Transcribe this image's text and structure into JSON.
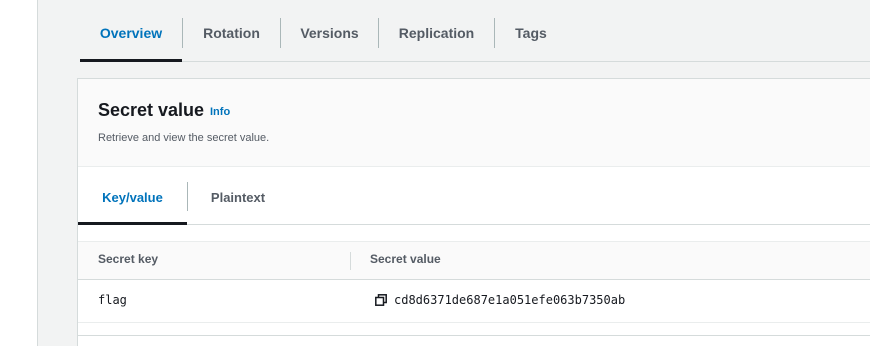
{
  "top_tabs": [
    {
      "label": "Overview",
      "active": true
    },
    {
      "label": "Rotation",
      "active": false
    },
    {
      "label": "Versions",
      "active": false
    },
    {
      "label": "Replication",
      "active": false
    },
    {
      "label": "Tags",
      "active": false
    }
  ],
  "secret_panel": {
    "title": "Secret value",
    "info_label": "Info",
    "description": "Retrieve and view the secret value."
  },
  "value_tabs": [
    {
      "label": "Key/value",
      "active": true
    },
    {
      "label": "Plaintext",
      "active": false
    }
  ],
  "table": {
    "headers": [
      "Secret key",
      "Secret value"
    ],
    "rows": [
      {
        "key": "flag",
        "value": "cd8d6371de687e1a051efe063b7350ab",
        "copy_icon": "copy-icon"
      }
    ]
  },
  "colors": {
    "accent": "#0073bb",
    "text": "#16191f",
    "muted": "#545b64",
    "border": "#d5dbdb",
    "background": "#f2f3f3"
  }
}
